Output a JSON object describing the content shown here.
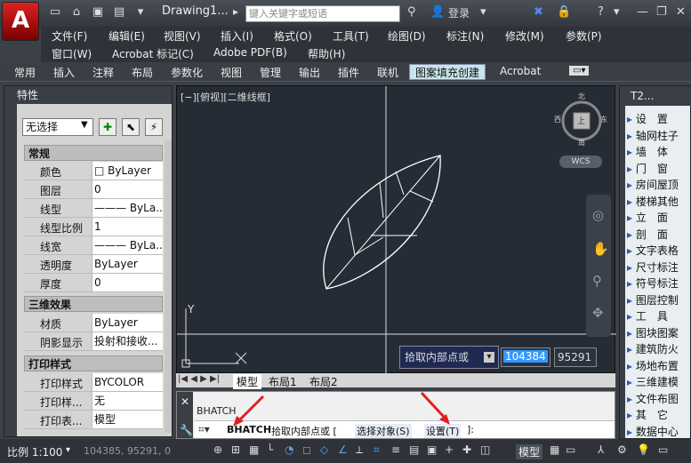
{
  "app_logo": "A",
  "document_title": "Drawing1...",
  "search_placeholder": "键入关键字或短语",
  "login": "登录",
  "menu1": [
    "文件(F)",
    "编辑(E)",
    "视图(V)",
    "插入(I)",
    "格式(O)",
    "工具(T)",
    "绘图(D)",
    "标注(N)",
    "修改(M)",
    "参数(P)"
  ],
  "menu2": [
    "窗口(W)",
    "Acrobat 标记(C)",
    "Adobe PDF(B)",
    "帮助(H)"
  ],
  "ribbon_tabs": [
    "常用",
    "插入",
    "注释",
    "布局",
    "参数化",
    "视图",
    "管理",
    "输出",
    "插件",
    "联机",
    "图案填充创建",
    "Acrobat"
  ],
  "properties": {
    "title": "特性",
    "selection": "无选择",
    "sections": {
      "general": "常规",
      "3d": "三维效果",
      "print": "打印样式"
    },
    "rows": [
      {
        "k": "颜色",
        "v": "□ ByLayer"
      },
      {
        "k": "图层",
        "v": "0"
      },
      {
        "k": "线型",
        "v": "——— ByLa..."
      },
      {
        "k": "线型比例",
        "v": "1"
      },
      {
        "k": "线宽",
        "v": "——— ByLa..."
      },
      {
        "k": "透明度",
        "v": "ByLayer"
      },
      {
        "k": "厚度",
        "v": "0"
      }
    ],
    "rows3d": [
      {
        "k": "材质",
        "v": "ByLayer"
      },
      {
        "k": "阴影显示",
        "v": "投射和接收..."
      }
    ],
    "rowsPrint": [
      {
        "k": "打印样式",
        "v": "BYCOLOR"
      },
      {
        "k": "打印样...",
        "v": "无"
      },
      {
        "k": "打印表...",
        "v": "模型"
      }
    ]
  },
  "viewport_label": "[−][俯视][二维线框]",
  "viewcube": {
    "n": "北",
    "s": "南",
    "e": "东",
    "w": "西",
    "top": "上",
    "wcs": "WCS"
  },
  "ucs_y": "Y",
  "prompt": {
    "label": "拾取内部点或",
    "x": "104384",
    "y": "95291"
  },
  "layout_tabs": [
    "模型",
    "布局1",
    "布局2"
  ],
  "command": {
    "name": "BHATCH",
    "line_cmd": "BHATCH",
    "line_text": "拾取内部点或 [",
    "opt1": "选择对象(S)",
    "opt2": "设置(T)",
    "line_end": "]:"
  },
  "tool_palette": {
    "title": "T2...",
    "items": [
      "设　置",
      "轴网柱子",
      "墙　体",
      "门　窗",
      "房间屋顶",
      "楼梯其他",
      "立　面",
      "剖　面",
      "文字表格",
      "尺寸标注",
      "符号标注",
      "图层控制",
      "工　具",
      "图块图案",
      "建筑防火",
      "场地布置",
      "三维建模",
      "文件布图",
      "其　它",
      "数据中心"
    ]
  },
  "status": {
    "scale": "比例 1:100",
    "coords": "104385, 95291, 0",
    "model": "模型"
  }
}
